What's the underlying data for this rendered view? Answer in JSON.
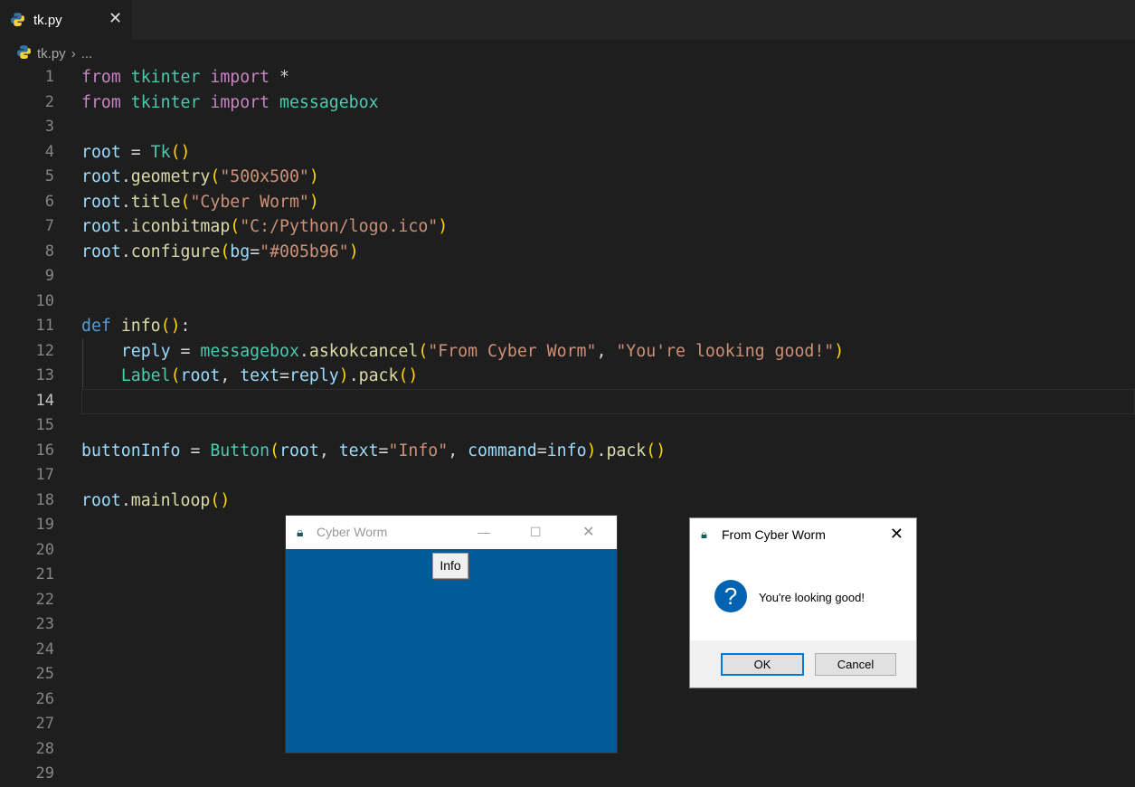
{
  "tab": {
    "label": "tk.py",
    "close": "✕"
  },
  "breadcrumb": {
    "file": "tk.py",
    "sep": "›",
    "rest": "..."
  },
  "editor": {
    "current_line": 14,
    "lines": [
      [
        [
          "from",
          "kw"
        ],
        [
          " "
        ],
        [
          "tkinter",
          "mod"
        ],
        [
          " "
        ],
        [
          "import",
          "kw"
        ],
        [
          " *"
        ]
      ],
      [
        [
          "from",
          "kw"
        ],
        [
          " "
        ],
        [
          "tkinter",
          "mod"
        ],
        [
          " "
        ],
        [
          "import",
          "kw"
        ],
        [
          " "
        ],
        [
          "messagebox",
          "mod"
        ]
      ],
      [],
      [
        [
          "root",
          "var"
        ],
        [
          " = "
        ],
        [
          "Tk",
          "mod"
        ],
        [
          "()",
          "b1"
        ]
      ],
      [
        [
          "root",
          "var"
        ],
        [
          "."
        ],
        [
          "geometry",
          "fn"
        ],
        [
          "(",
          "b1"
        ],
        [
          "\"500x500\"",
          "str"
        ],
        [
          ")",
          "b1"
        ]
      ],
      [
        [
          "root",
          "var"
        ],
        [
          "."
        ],
        [
          "title",
          "fn"
        ],
        [
          "(",
          "b1"
        ],
        [
          "\"Cyber Worm\"",
          "str"
        ],
        [
          ")",
          "b1"
        ]
      ],
      [
        [
          "root",
          "var"
        ],
        [
          "."
        ],
        [
          "iconbitmap",
          "fn"
        ],
        [
          "(",
          "b1"
        ],
        [
          "\"C:/Python/logo.ico\"",
          "str"
        ],
        [
          ")",
          "b1"
        ]
      ],
      [
        [
          "root",
          "var"
        ],
        [
          "."
        ],
        [
          "configure",
          "fn"
        ],
        [
          "(",
          "b1"
        ],
        [
          "bg",
          "var"
        ],
        [
          "="
        ],
        [
          "\"#005b96\"",
          "str"
        ],
        [
          ")",
          "b1"
        ]
      ],
      [],
      [],
      [
        [
          "def",
          "def"
        ],
        [
          " "
        ],
        [
          "info",
          "fn"
        ],
        [
          "()",
          "b1"
        ],
        [
          ":"
        ]
      ],
      [
        [
          "    "
        ],
        [
          "reply",
          "var"
        ],
        [
          " = "
        ],
        [
          "messagebox",
          "mod"
        ],
        [
          "."
        ],
        [
          "askokcancel",
          "fn"
        ],
        [
          "(",
          "b1"
        ],
        [
          "\"From Cyber Worm\"",
          "str"
        ],
        [
          ", "
        ],
        [
          "\"You're looking good!\"",
          "str"
        ],
        [
          ")",
          "b1"
        ]
      ],
      [
        [
          "    "
        ],
        [
          "Label",
          "mod"
        ],
        [
          "(",
          "b1"
        ],
        [
          "root",
          "var"
        ],
        [
          ", "
        ],
        [
          "text",
          "var"
        ],
        [
          "="
        ],
        [
          "reply",
          "var"
        ],
        [
          ")",
          "b1"
        ],
        [
          "."
        ],
        [
          "pack",
          "fn"
        ],
        [
          "()",
          "b1"
        ]
      ],
      [],
      [],
      [
        [
          "buttonInfo",
          "var"
        ],
        [
          " = "
        ],
        [
          "Button",
          "mod"
        ],
        [
          "(",
          "b1"
        ],
        [
          "root",
          "var"
        ],
        [
          ", "
        ],
        [
          "text",
          "var"
        ],
        [
          "="
        ],
        [
          "\"Info\"",
          "str"
        ],
        [
          ", "
        ],
        [
          "command",
          "var"
        ],
        [
          "="
        ],
        [
          "info",
          "var"
        ],
        [
          ")",
          "b1"
        ],
        [
          "."
        ],
        [
          "pack",
          "fn"
        ],
        [
          "()",
          "b1"
        ]
      ],
      [],
      [
        [
          "root",
          "var"
        ],
        [
          "."
        ],
        [
          "mainloop",
          "fn"
        ],
        [
          "()",
          "b1"
        ]
      ],
      [],
      [],
      [],
      [],
      [],
      [],
      [],
      [],
      [],
      [],
      []
    ]
  },
  "tk_window": {
    "title": "Cyber Worm",
    "button": "Info",
    "minimize": "—",
    "maximize": "☐",
    "close": "✕",
    "bg": "#005b96"
  },
  "dialog": {
    "title": "From Cyber Worm",
    "close": "✕",
    "icon": "?",
    "message": "You're looking good!",
    "ok": "OK",
    "cancel": "Cancel"
  }
}
